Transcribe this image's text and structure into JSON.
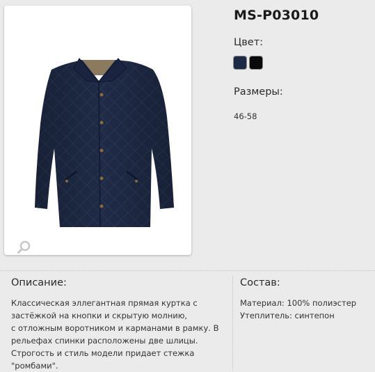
{
  "product": {
    "title": "MS-P03010",
    "color_label": "Цвет:",
    "colors": [
      {
        "name": "navy-swatch",
        "hex": "#1e2a45"
      },
      {
        "name": "black-swatch",
        "hex": "#0a0a0a"
      }
    ],
    "sizes_label": "Размеры:",
    "sizes_value": "46-58"
  },
  "description": {
    "label": "Описание:",
    "lines": [
      "Классическая эллегантная прямая куртка с",
      "застёжкой на кнопки и скрытую молнию,",
      "с отложным воротником и карманами в рамку. В",
      "рельефах спинки расположены две шлицы.",
      "Строгость и стиль модели придает стежка",
      "\"ромбами\"."
    ]
  },
  "composition": {
    "label": "Состав:",
    "material": "Материал: 100% полиэстер",
    "filling": "Утеплитель: синтепон"
  },
  "icons": {
    "zoom": "magnifier-icon"
  },
  "colors": {
    "page_bg": "#ebebeb",
    "jacket": "#1e2a45"
  }
}
